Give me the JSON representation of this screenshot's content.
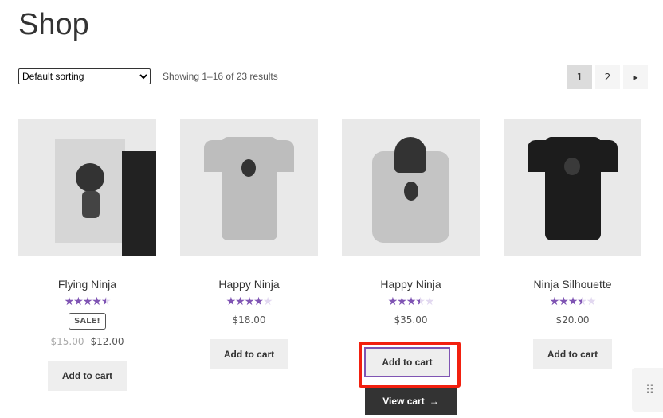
{
  "page": {
    "title": "Shop"
  },
  "toolbar": {
    "sort_selected": "Default sorting",
    "result_count": "Showing 1–16 of 23 results"
  },
  "pagination": {
    "pages": [
      "1",
      "2"
    ],
    "current": "1",
    "next_icon": "chevron-right-icon"
  },
  "colors": {
    "accent": "#7f54b3",
    "highlight": "#f2200f"
  },
  "products": [
    {
      "name": "Flying Ninja",
      "rating": 4.5,
      "sale_badge": "SALE!",
      "old_price": "$15.00",
      "price": "$12.00",
      "button": "Add to cart"
    },
    {
      "name": "Happy Ninja",
      "rating": 4,
      "price": "$18.00",
      "button": "Add to cart"
    },
    {
      "name": "Happy Ninja",
      "rating": 3.5,
      "price": "$35.00",
      "button": "Add to cart",
      "view_cart": "View cart"
    },
    {
      "name": "Ninja Silhouette",
      "rating": 3.5,
      "price": "$20.00",
      "button": "Add to cart"
    }
  ]
}
